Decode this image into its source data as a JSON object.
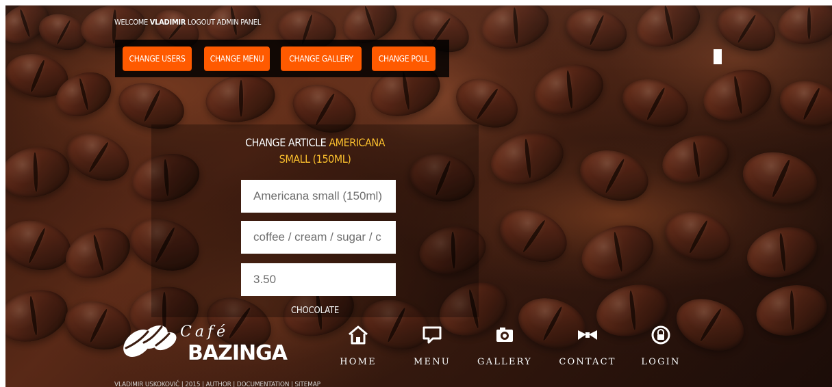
{
  "header": {
    "welcome_prefix": "WELCOME",
    "username": "VLADIMIR",
    "logout": "LOGOUT",
    "admin_panel": "ADMIN PANEL"
  },
  "admin_menu": {
    "buttons": [
      {
        "label": "CHANGE USERS"
      },
      {
        "label": "CHANGE MENU"
      },
      {
        "label": "CHANGE GALLERY"
      },
      {
        "label": "CHANGE POLL"
      }
    ],
    "accent_color": "#ff5a00"
  },
  "edit_article": {
    "title_prefix": "CHANGE ARTICLE",
    "title_highlight": "AMERICANA SMALL (150ML)",
    "name_value": "Americana small (150ml)",
    "ingredients_value": "coffee / cream / sugar / c",
    "price_value": "3.50",
    "category": "CHOCOLATE",
    "highlight_color": "#ffc12f"
  },
  "branding": {
    "script": "Café",
    "main": "BAZINGA"
  },
  "navigation": [
    {
      "label": "HOME",
      "icon": "home-icon"
    },
    {
      "label": "MENU",
      "icon": "chat-icon"
    },
    {
      "label": "GALLERY",
      "icon": "camera-icon"
    },
    {
      "label": "CONTACT",
      "icon": "bow-tie-icon"
    },
    {
      "label": "LOGIN",
      "icon": "lock-icon"
    }
  ],
  "footer": {
    "text": "VLADIMIR USKOKOVIĆ | 2015 | AUTHOR | DOCUMENTATION | SITEMAP"
  },
  "background": {
    "theme": "coffee beans"
  }
}
